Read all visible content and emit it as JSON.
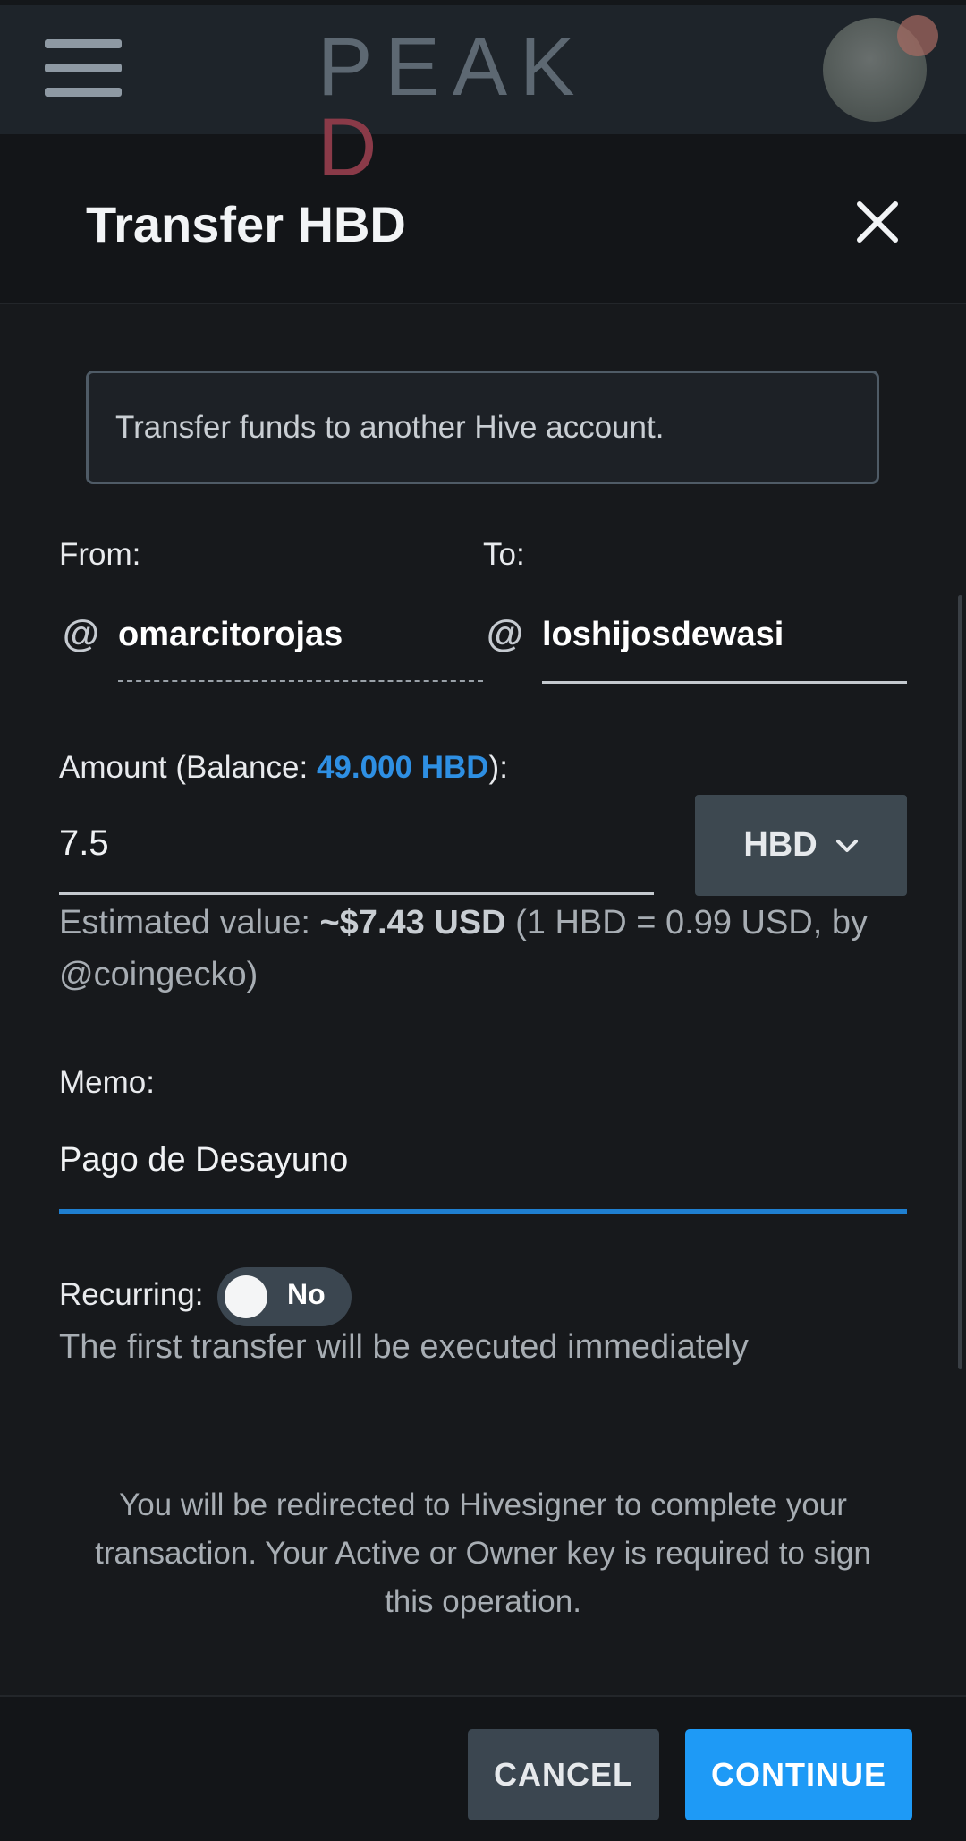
{
  "appbar": {
    "logo": "PEAKD",
    "menu_icon": "hamburger-icon",
    "avatar": "user-avatar"
  },
  "modal": {
    "title": "Transfer HBD",
    "close_icon": "close-icon",
    "info": "Transfer funds to another Hive account.",
    "from_label": "From:",
    "to_label": "To:",
    "at_symbol": "@",
    "from_user": "omarcitorojas",
    "to_user": "loshijosdewasi",
    "amount_label_prefix": "Amount (Balance: ",
    "balance": "49.000 HBD",
    "amount_label_suffix": "):",
    "amount": "7.5",
    "currency": "HBD",
    "estimate_prefix": "Estimated value: ",
    "estimate_value": "~$7.43 USD",
    "estimate_suffix": " (1 HBD = 0.99 USD, by @coingecko)",
    "memo_label": "Memo:",
    "memo": "Pago de Desayuno",
    "recurring_label": "Recurring:",
    "recurring_value": "No",
    "recurring_note": "The first transfer will be executed immediately",
    "redirect_note": "You will be redirected to Hivesigner to complete your transaction. Your Active or Owner key is required to sign this operation.",
    "cancel": "CANCEL",
    "continue": "CONTINUE"
  },
  "colors": {
    "accent": "#1e9af6",
    "balance": "#2e8fe3",
    "background": "#17191c"
  }
}
